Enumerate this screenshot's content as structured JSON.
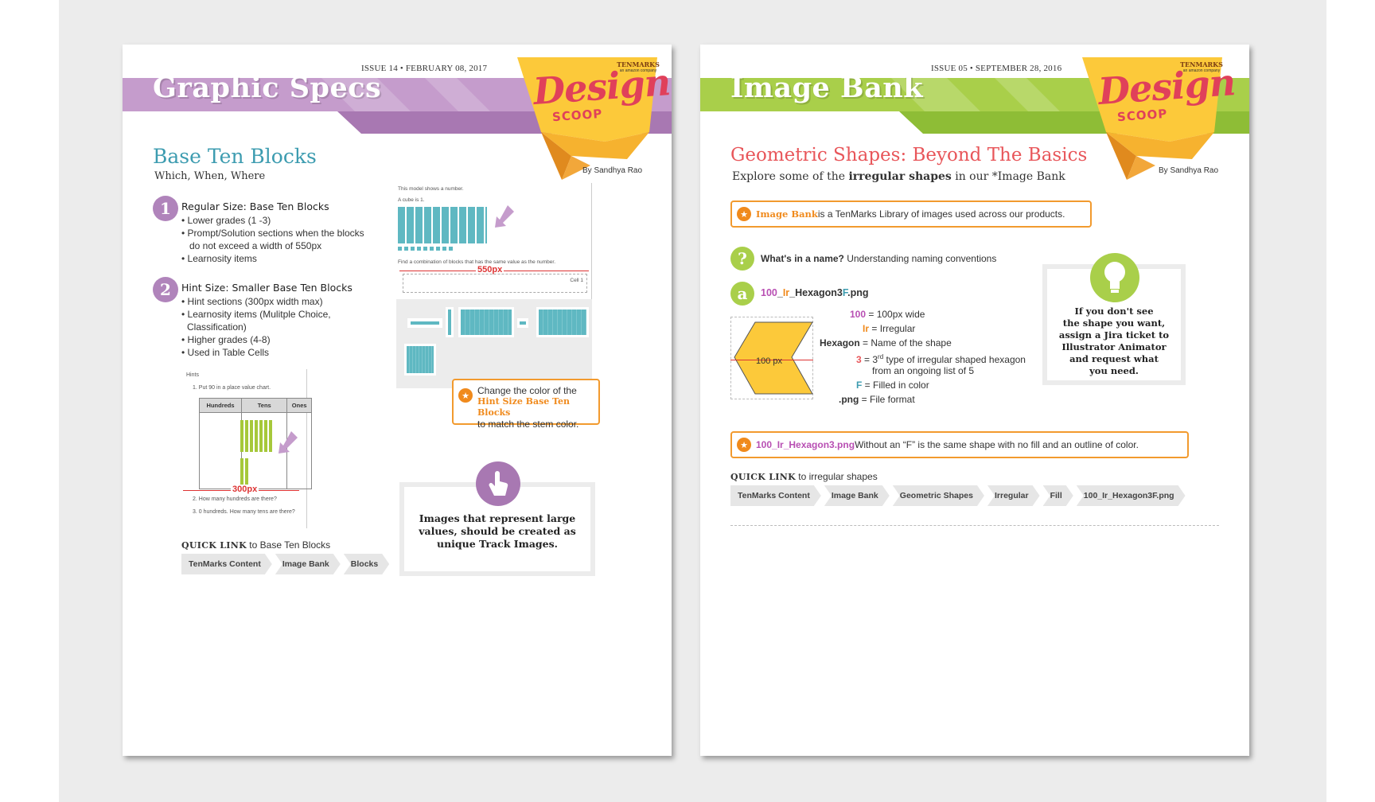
{
  "sheet1": {
    "issue": "ISSUE 14 • FEBRUARY 08, 2017",
    "title": "Graphic Specs",
    "logo": {
      "brand": "TENMARKS",
      "brand_sub": "an amazon company",
      "word1": "Design",
      "word2": "SCOOP"
    },
    "byline": "By Sandhya Rao",
    "heading": "Base Ten Blocks",
    "subheading": "Which, When, Where",
    "sections": [
      {
        "num": "1",
        "title": "Regular Size: Base Ten Blocks",
        "bullets": [
          "• Lower grades (1 -3)",
          "• Prompt/Solution sections when the blocks",
          "   do not exceed a width of 550px",
          " • Learnosity items"
        ]
      },
      {
        "num": "2",
        "title": "Hint Size: Smaller Base Ten Blocks",
        "bullets": [
          "• Hint sections (300px width max)",
          "• Learnosity items (Mulitple Choice,",
          "  Classification)",
          "• Higher grades (4-8)",
          "• Used in Table Cells"
        ]
      }
    ],
    "hint_example": {
      "label": "Hints",
      "step1": "1. Put 90 in a place value chart.",
      "headers": [
        "Hundreds",
        "Tens",
        "Ones"
      ],
      "width_label": "300px",
      "step2": "2. How many hundreds are there?",
      "step3": "3. 0 hundreds. How many tens are there?"
    },
    "regular_example": {
      "line1": "This model shows a number.",
      "line2": "A cube is 1.",
      "line3": "Find a combination of blocks that has the same value as the number.",
      "width_label": "550px",
      "cell_label": "Cell 1"
    },
    "color_note": {
      "pre": "Change the color of the",
      "highlight": "Hint Size Base Ten Blocks",
      "post": "to match the stem color."
    },
    "tip": {
      "lines": [
        "Images that represent large",
        "values, should be created as",
        "unique Track Images."
      ]
    },
    "quick_link": {
      "bold": "QUICK LINK",
      "text": " to Base Ten Blocks"
    },
    "crumbs": [
      "TenMarks Content",
      "Image Bank",
      "Blocks"
    ]
  },
  "sheet2": {
    "issue": "ISSUE 05 • SEPTEMBER 28, 2016",
    "title": "Image Bank",
    "logo": {
      "brand": "TENMARKS",
      "brand_sub": "an amazon company",
      "word1": "Design",
      "word2": "SCOOP"
    },
    "byline": "By Sandhya Rao",
    "heading": "Geometric Shapes: Beyond The Basics",
    "subheading": {
      "pre": "Explore some of the ",
      "bold": "irregular shapes",
      "post": " in our *Image Bank"
    },
    "note1": {
      "highlight": "Image Bank",
      "text": " is a TenMarks Library of images used across our products."
    },
    "question": {
      "mark": "?",
      "bold": "What's in a name?",
      "text": " Understanding naming conventions"
    },
    "example": {
      "letter": "a",
      "filename": {
        "p1": "100",
        "p2": "_",
        "p3": "Ir",
        "p4": "_Hexagon3",
        "p5": "F",
        "p6": ".png"
      },
      "shape_label": "100 px",
      "parts": [
        {
          "key": "100",
          "desc": " = 100px wide"
        },
        {
          "key": "Ir",
          "desc": " = Irregular"
        },
        {
          "key": "Hexagon",
          "desc": " = Name of the shape"
        },
        {
          "key": "3",
          "desc": " = 3",
          "sup": "rd",
          "desc2": " type of irregular shaped hexagon",
          "desc3": "from an ongoing list of 5"
        },
        {
          "key": "F",
          "desc": " = Filled in color"
        },
        {
          "key": ".png",
          "desc": " = File format"
        }
      ]
    },
    "tip": {
      "lines": [
        "If you don't see",
        "the shape you want,",
        "assign a Jira ticket to",
        "Illustrator Animator",
        "and request what",
        "you need."
      ]
    },
    "note2": {
      "bold": "100_Ir_Hexagon3.png",
      "text": " Without an “F” is the same shape with no fill and an outline of color."
    },
    "quick_link": {
      "bold": "QUICK LINK",
      "text": " to irregular shapes"
    },
    "crumbs": [
      "TenMarks Content",
      "Image Bank",
      "Geometric Shapes",
      "Irregular",
      "Fill",
      "100_Ir_Hexagon3F.png"
    ]
  },
  "colors": {
    "purple": "#c59ccc",
    "purple_dark": "#a878b2",
    "green": "#a9cf4a",
    "green_dark": "#8ebd36",
    "teal": "#3d9cb0",
    "coral": "#e8565a",
    "orange": "#f08a1c",
    "logo_yellow": "#fcc93a"
  }
}
